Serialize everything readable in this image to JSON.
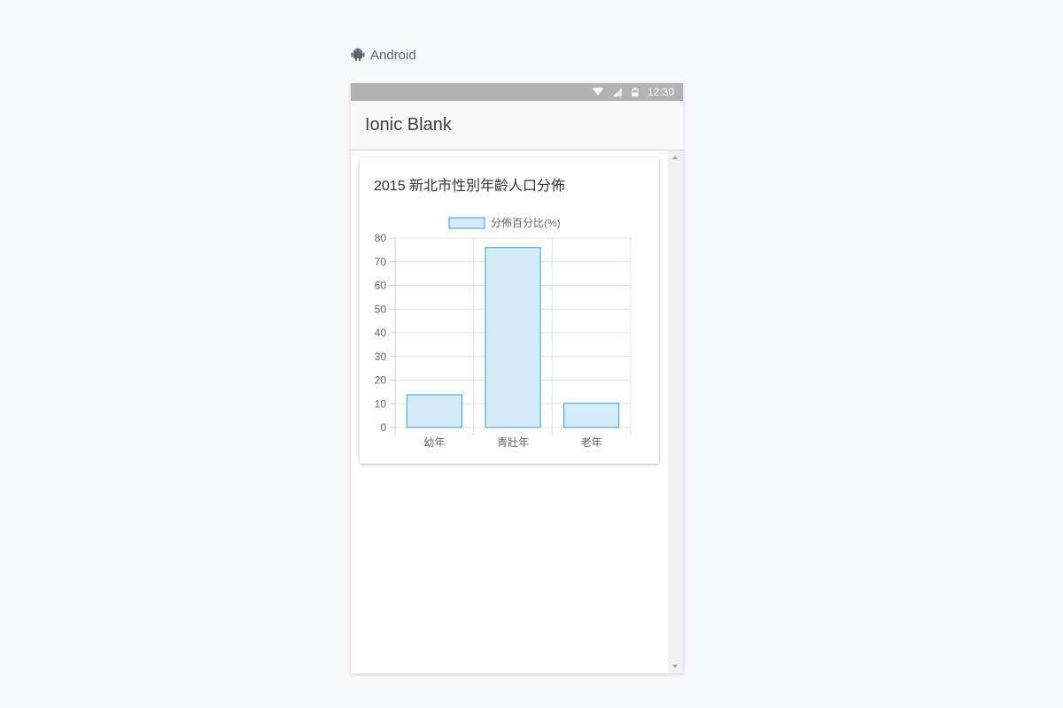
{
  "platform": {
    "label": "Android",
    "icon": "android-icon"
  },
  "status_bar": {
    "time": "12:30",
    "icons": [
      "wifi-icon",
      "signal-icon",
      "battery-icon"
    ]
  },
  "toolbar": {
    "title": "Ionic Blank"
  },
  "card": {
    "title": "2015 新北市性別年齡人口分佈"
  },
  "colors": {
    "bar_fill": "#d6ebf8",
    "bar_stroke": "#3b9be0",
    "grid": "#e2e2e2",
    "status_bar": "#b3b3b3"
  },
  "chart_data": {
    "type": "bar",
    "categories": [
      "幼年",
      "青壯年",
      "老年"
    ],
    "series": [
      {
        "name": "分佈百分比(%)",
        "values": [
          13.8,
          76,
          10.2
        ]
      }
    ],
    "ylim": [
      0,
      80
    ],
    "yticks": [
      0,
      10,
      20,
      30,
      40,
      50,
      60,
      70,
      80
    ],
    "grid": true,
    "legend": "top"
  }
}
